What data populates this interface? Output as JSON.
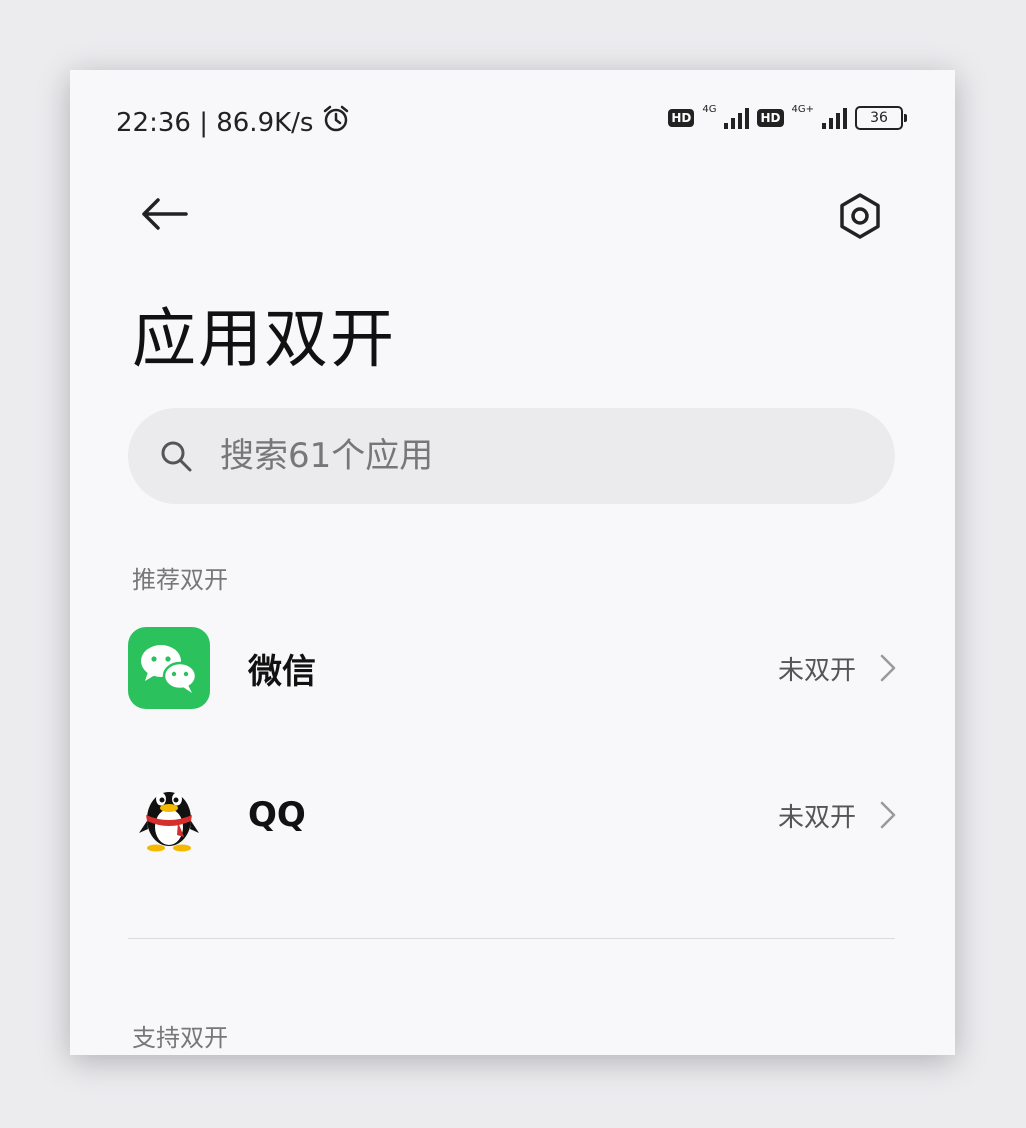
{
  "status_bar": {
    "time_speed": "22:36 | 86.9K/s",
    "hd1": "HD",
    "net1": "4G",
    "hd2": "HD",
    "net2": "4G+",
    "battery": "36",
    "alarm_icon": "alarm-clock-icon"
  },
  "header": {
    "back_icon": "back-arrow-icon",
    "settings_icon": "settings-gear-icon",
    "title": "应用双开"
  },
  "search": {
    "placeholder": "搜索61个应用"
  },
  "sections": {
    "recommended": "推荐双开",
    "supported": "支持双开"
  },
  "apps": [
    {
      "name": "微信",
      "status": "未双开",
      "icon": "wechat-icon",
      "color": "#2bc25e"
    },
    {
      "name": "QQ",
      "status": "未双开",
      "icon": "qq-penguin-icon",
      "color": "#d62d2d"
    }
  ],
  "colors": {
    "accent_green": "#2bc25e",
    "background": "#f8f8fa",
    "search_bg": "#ebebee"
  }
}
